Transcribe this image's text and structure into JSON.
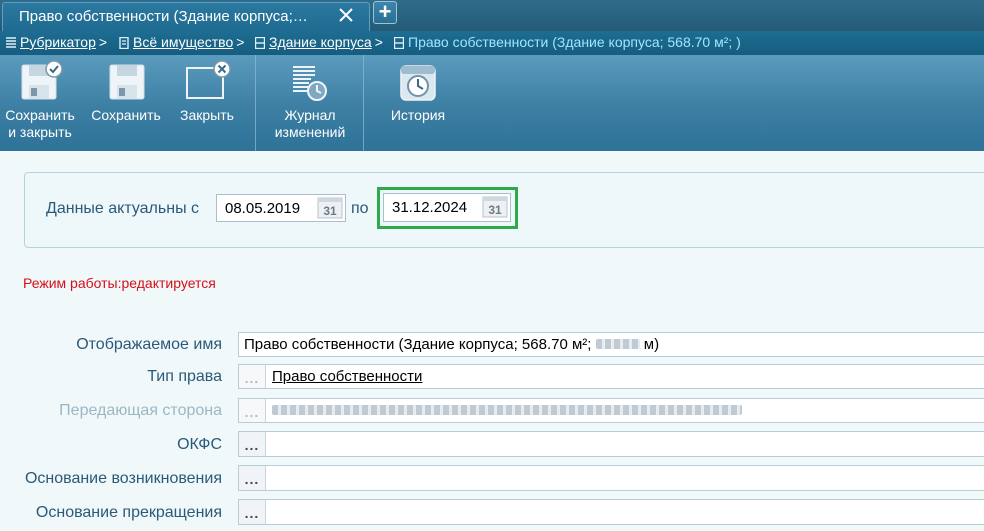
{
  "tab": {
    "title": "Право собственности (Здание корпуса;…",
    "add_label": "+"
  },
  "breadcrumb": {
    "items": [
      {
        "label": "Рубрикатор",
        "sep": ">"
      },
      {
        "label": "Всё имущество",
        "sep": ">"
      },
      {
        "label": "Здание корпуса",
        "sep": ">"
      }
    ],
    "current": "Право собственности (Здание корпуса; 568.70 м²;            )"
  },
  "toolbar": {
    "save_close": {
      "line1": "Сохранить",
      "line2": "и закрыть"
    },
    "save": "Сохранить",
    "close": "Закрыть",
    "journal": {
      "line1": "Журнал",
      "line2": "изменений"
    },
    "history": "История"
  },
  "dates": {
    "label": "Данные актуальны с",
    "from": "08.05.2019",
    "to_label": "по",
    "to": "31.12.2024",
    "cal_text": "31"
  },
  "mode": "Режим работы:редактируется",
  "form": {
    "display_name": {
      "label": "Отображаемое имя",
      "value": "Право собственности (Здание корпуса; 568.70 м²;",
      "value_end": "м)"
    },
    "right_type": {
      "label": "Тип права",
      "value": "Право собственности"
    },
    "transferring_party": {
      "label": "Передающая сторона"
    },
    "okfs": {
      "label": "ОКФС",
      "value": ""
    },
    "origin_basis": {
      "label": "Основание возникновения",
      "value": ""
    },
    "termination_basis": {
      "label": "Основание прекращения",
      "value": ""
    },
    "picker_dots": "..."
  },
  "colors": {
    "accent": "#2faa4b",
    "mode_text": "#d6101a",
    "toolbar": "#3c7fa3",
    "link": "#1a5b8f"
  }
}
